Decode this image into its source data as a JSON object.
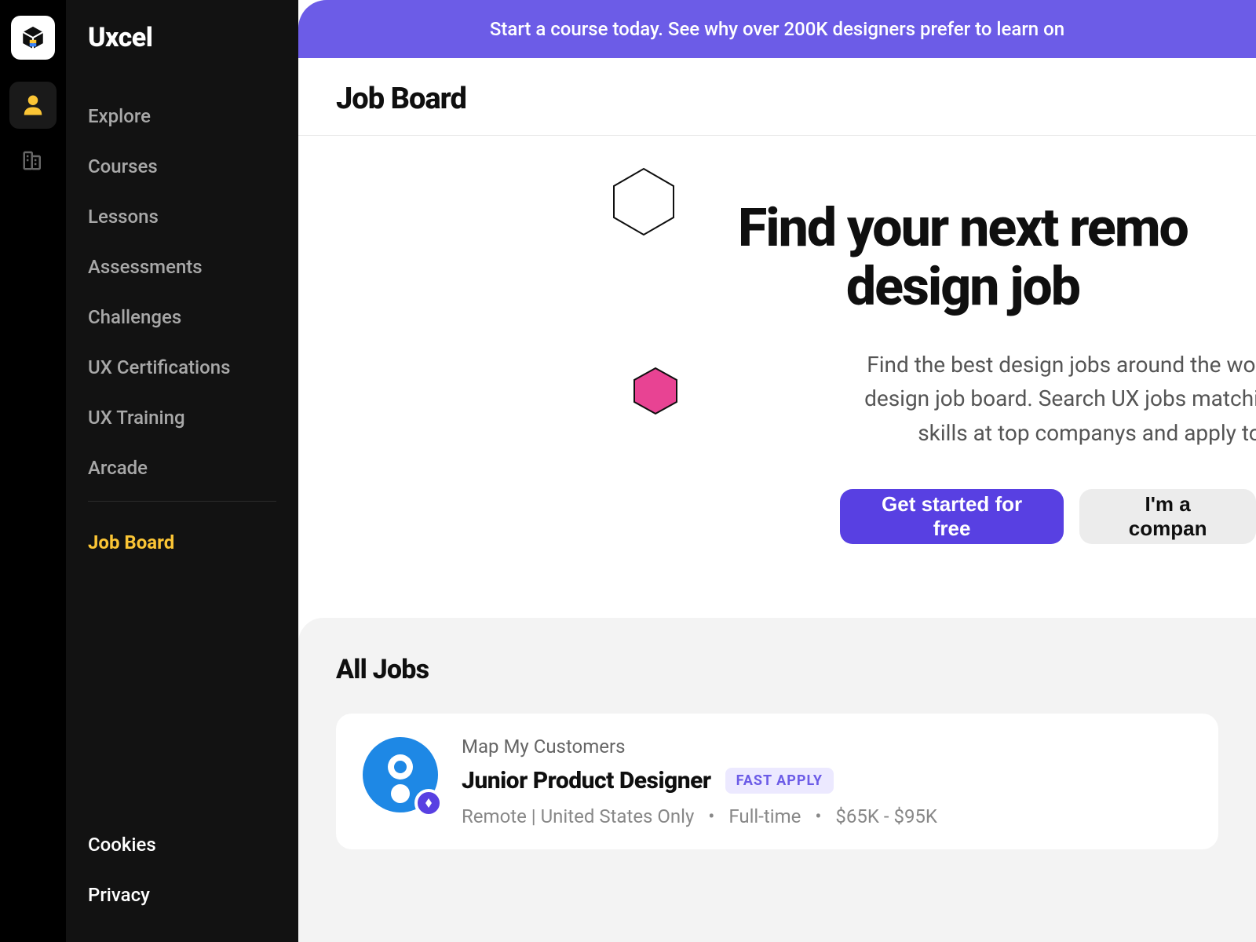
{
  "brand": "Uxcel",
  "banner": "Start a course today. See why over 200K designers prefer to learn on",
  "page_title": "Job Board",
  "sidebar": {
    "items": [
      {
        "label": "Explore"
      },
      {
        "label": "Courses"
      },
      {
        "label": "Lessons"
      },
      {
        "label": "Assessments"
      },
      {
        "label": "Challenges"
      },
      {
        "label": "UX Certifications"
      },
      {
        "label": "UX Training"
      },
      {
        "label": "Arcade"
      }
    ],
    "active": {
      "label": "Job Board"
    },
    "footer": [
      {
        "label": "Cookies"
      },
      {
        "label": "Privacy"
      }
    ]
  },
  "hero": {
    "line1": "Find your next remo",
    "line2": "design job",
    "subtitle": "Find the best design jobs around the world here o\ndesign job board. Search UX jobs matching your ti\nskills at top companys and apply today",
    "cta_primary": "Get started for free",
    "cta_secondary": "I'm a compan"
  },
  "jobs": {
    "section_title": "All Jobs",
    "items": [
      {
        "company": "Map My Customers",
        "title": "Junior Product Designer",
        "badge": "FAST APPLY",
        "location": "Remote | United States Only",
        "type": "Full-time",
        "salary": "$65K - $95K"
      }
    ]
  }
}
